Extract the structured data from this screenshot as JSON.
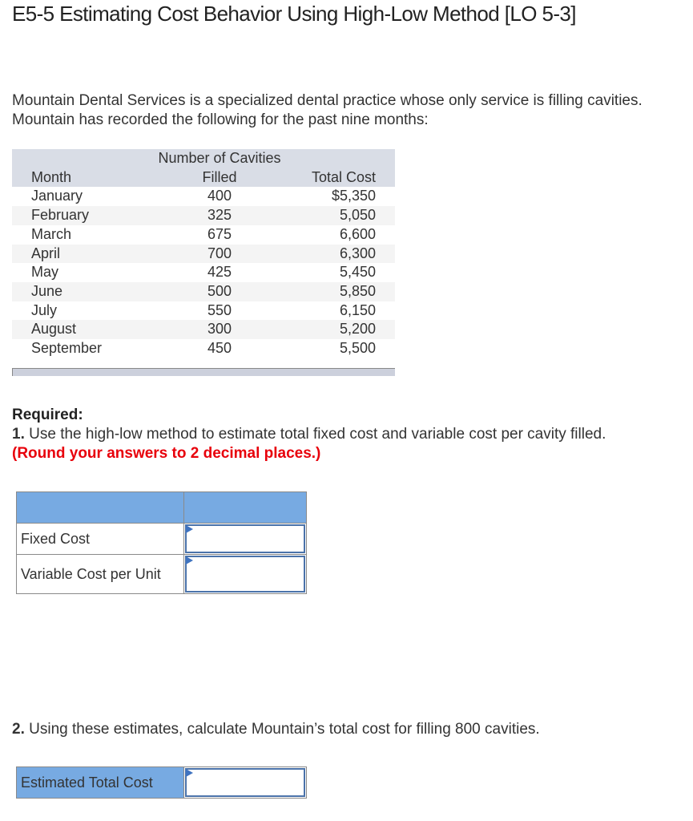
{
  "title": "E5-5 Estimating Cost Behavior Using High-Low Method [LO 5-3]",
  "intro": "Mountain Dental Services is a specialized dental practice whose only service is filling cavities. Mountain has recorded the following for the past nine months:",
  "table": {
    "headers": {
      "month": "Month",
      "cavities_line1": "Number of Cavities",
      "cavities_line2": "Filled",
      "cost": "Total Cost"
    },
    "rows": [
      {
        "month": "January",
        "cavities": "400",
        "cost": "$5,350"
      },
      {
        "month": "February",
        "cavities": "325",
        "cost": "5,050"
      },
      {
        "month": "March",
        "cavities": "675",
        "cost": "6,600"
      },
      {
        "month": "April",
        "cavities": "700",
        "cost": "6,300"
      },
      {
        "month": "May",
        "cavities": "425",
        "cost": "5,450"
      },
      {
        "month": "June",
        "cavities": "500",
        "cost": "5,850"
      },
      {
        "month": "July",
        "cavities": "550",
        "cost": "6,150"
      },
      {
        "month": "August",
        "cavities": "300",
        "cost": "5,200"
      },
      {
        "month": "September",
        "cavities": "450",
        "cost": "5,500"
      }
    ]
  },
  "required": {
    "label": "Required:",
    "q1_number": "1.",
    "q1_text": " Use the high-low method to estimate total fixed cost and variable cost per cavity filled.",
    "q1_note": "(Round your answers to 2 decimal places.)"
  },
  "answer_table": {
    "rows": [
      {
        "label": "Fixed Cost",
        "value": ""
      },
      {
        "label": "Variable Cost per Unit",
        "value": ""
      }
    ]
  },
  "q2": {
    "number": "2.",
    "text": " Using these estimates, calculate Mountain’s total cost for filling 800 cavities."
  },
  "estimate": {
    "label": "Estimated Total Cost",
    "value": ""
  },
  "colors": {
    "header_blue": "#77aae2",
    "input_border": "#4b73aa",
    "note_red": "#e8000b",
    "table_header_gray": "#d9dde6"
  }
}
